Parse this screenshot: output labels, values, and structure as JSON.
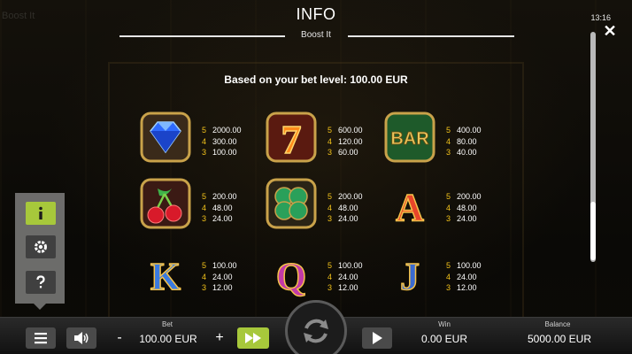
{
  "header": {
    "game_title": "Boost It",
    "title": "INFO",
    "subtitle": "Boost It",
    "clock": "13:16",
    "close_label": "✕"
  },
  "paytable": {
    "bet_note": "Based on your bet level: 100.00 EUR",
    "symbols": [
      {
        "name": "diamond",
        "pays": [
          {
            "count": "5",
            "value": "2000.00"
          },
          {
            "count": "4",
            "value": "300.00"
          },
          {
            "count": "3",
            "value": "100.00"
          }
        ]
      },
      {
        "name": "seven",
        "pays": [
          {
            "count": "5",
            "value": "600.00"
          },
          {
            "count": "4",
            "value": "120.00"
          },
          {
            "count": "3",
            "value": "60.00"
          }
        ]
      },
      {
        "name": "bar",
        "pays": [
          {
            "count": "5",
            "value": "400.00"
          },
          {
            "count": "4",
            "value": "80.00"
          },
          {
            "count": "3",
            "value": "40.00"
          }
        ]
      },
      {
        "name": "cherry",
        "pays": [
          {
            "count": "5",
            "value": "200.00"
          },
          {
            "count": "4",
            "value": "48.00"
          },
          {
            "count": "3",
            "value": "24.00"
          }
        ]
      },
      {
        "name": "clover",
        "pays": [
          {
            "count": "5",
            "value": "200.00"
          },
          {
            "count": "4",
            "value": "48.00"
          },
          {
            "count": "3",
            "value": "24.00"
          }
        ]
      },
      {
        "name": "letter-a",
        "pays": [
          {
            "count": "5",
            "value": "200.00"
          },
          {
            "count": "4",
            "value": "48.00"
          },
          {
            "count": "3",
            "value": "24.00"
          }
        ]
      },
      {
        "name": "letter-k",
        "pays": [
          {
            "count": "5",
            "value": "100.00"
          },
          {
            "count": "4",
            "value": "24.00"
          },
          {
            "count": "3",
            "value": "12.00"
          }
        ]
      },
      {
        "name": "letter-q",
        "pays": [
          {
            "count": "5",
            "value": "100.00"
          },
          {
            "count": "4",
            "value": "24.00"
          },
          {
            "count": "3",
            "value": "12.00"
          }
        ]
      },
      {
        "name": "letter-j",
        "pays": [
          {
            "count": "5",
            "value": "100.00"
          },
          {
            "count": "4",
            "value": "24.00"
          },
          {
            "count": "3",
            "value": "12.00"
          }
        ]
      }
    ],
    "symbol_glyphs": {
      "bar": "BAR",
      "a": "A",
      "k": "K",
      "q": "Q",
      "j": "J",
      "seven": "7"
    }
  },
  "side_menu": {
    "items": [
      {
        "icon": "info-icon",
        "active": true
      },
      {
        "icon": "gear-icon",
        "active": false
      },
      {
        "icon": "help-icon",
        "active": false
      }
    ]
  },
  "bottom_bar": {
    "bet_label": "Bet",
    "bet_value": "100.00 EUR",
    "minus_label": "-",
    "plus_label": "+",
    "win_label": "Win",
    "win_value": "0.00 EUR",
    "balance_label": "Balance",
    "balance_value": "5000.00 EUR"
  },
  "colors": {
    "accent_green": "#a7c83b",
    "pay_count_gold": "#f2c21a"
  }
}
